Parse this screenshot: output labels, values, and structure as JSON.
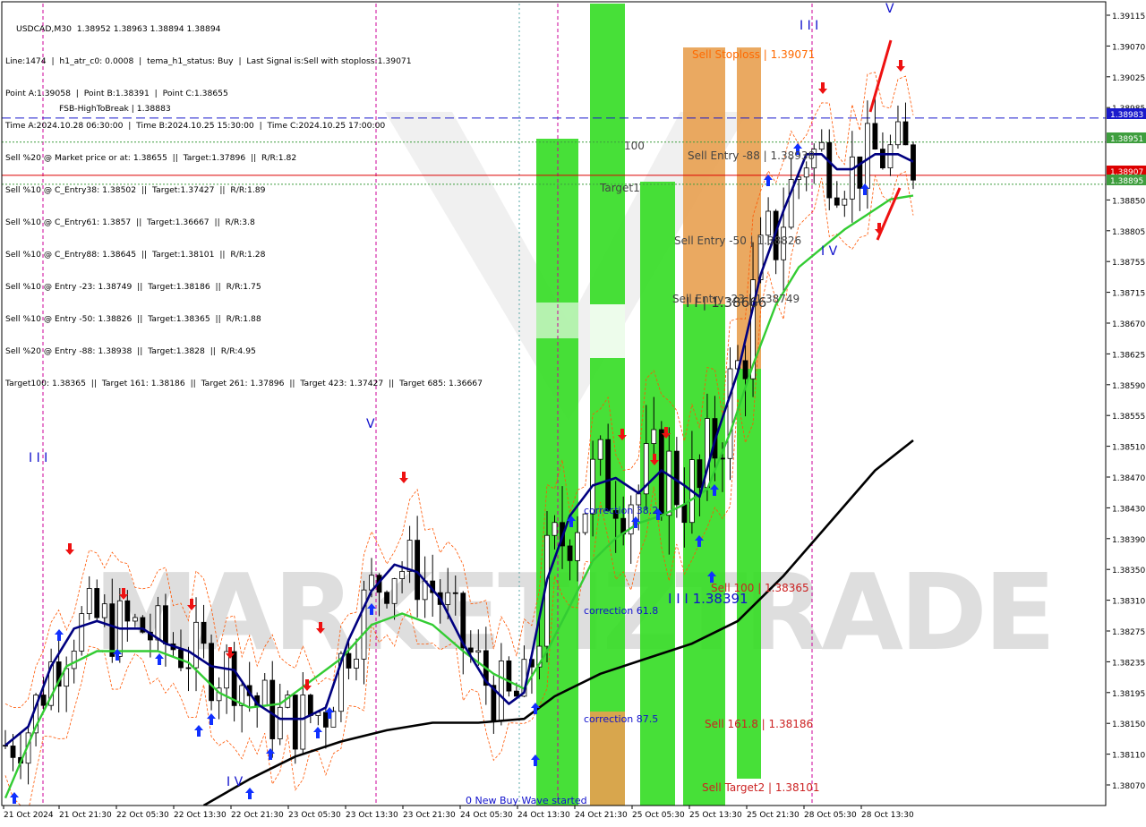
{
  "header": {
    "symbol_line": "USDCAD,M30  1.38952 1.38963 1.38894 1.38894",
    "info_lines": [
      "Line:1474  |  h1_atr_c0: 0.0008  |  tema_h1_status: Buy  |  Last Signal is:Sell with stoploss:1.39071",
      "Point A:1.39058  |  Point B:1.38391  |  Point C:1.38655",
      "Time A:2024.10.28 06:30:00  |  Time B:2024.10.25 15:30:00  |  Time C:2024.10.25 17:00:00",
      "Sell %20 @ Market price or at: 1.38655  ||  Target:1.37896  ||  R/R:1.82",
      "Sell %10 @ C_Entry38: 1.38502  ||  Target:1.37427  ||  R/R:1.89",
      "Sell %10 @ C_Entry61: 1.3857  ||  Target:1.36667  ||  R/R:3.8",
      "Sell %10 @ C_Entry88: 1.38645  ||  Target:1.38101  ||  R/R:1.28",
      "Sell %10 @ Entry -23: 1.38749  ||  Target:1.38186  ||  R/R:1.75",
      "Sell %10 @ Entry -50: 1.38826  ||  Target:1.38365  ||  R/R:1.88",
      "Sell %20 @ Entry -88: 1.38938  ||  Target:1.3828  ||  R/R:4.95",
      "Target100: 1.38365  ||  Target 161: 1.38186  ||  Target 261: 1.37896  ||  Target 423: 1.37427  ||  Target 685: 1.36667"
    ],
    "overlap_text": "FSB-HighToBreak | 1.38883"
  },
  "watermark": "MARKETIZTRADE",
  "price_axis": {
    "ticks": [
      "1.39115",
      "1.39070",
      "1.39025",
      "1.38985",
      "1.38940",
      "1.38895",
      "1.38850",
      "1.38805",
      "1.38755",
      "1.38715",
      "1.38670",
      "1.38625",
      "1.38590",
      "1.38555",
      "1.38510",
      "1.38470",
      "1.38430",
      "1.38390",
      "1.38350",
      "1.38310",
      "1.38275",
      "1.38235",
      "1.38195",
      "1.38150",
      "1.38110",
      "1.38070"
    ],
    "markers": [
      {
        "text": "1.38983",
        "color": "#1a1acc"
      },
      {
        "text": "1.38951",
        "color": "#3e9e3e"
      },
      {
        "text": "1.38907",
        "color": "#dd0000"
      },
      {
        "text": "1.38895",
        "color": "#3e9e3e"
      }
    ]
  },
  "time_axis": {
    "labels": [
      "21 Oct 2024",
      "21 Oct 21:30",
      "22 Oct 05:30",
      "22 Oct 13:30",
      "22 Oct 21:30",
      "23 Oct 05:30",
      "23 Oct 13:30",
      "23 Oct 21:30",
      "24 Oct 05:30",
      "24 Oct 13:30",
      "24 Oct 21:30",
      "25 Oct 05:30",
      "25 Oct 13:30",
      "25 Oct 21:30",
      "28 Oct 05:30",
      "28 Oct 13:30"
    ]
  },
  "annotations": {
    "sell_stoploss": "Sell Stoploss | 1.39071",
    "sell_entry_88": "Sell Entry -88 | 1.38938",
    "sell_entry_50": "Sell Entry -50 | 1.38826",
    "sell_entry_23": "Sell Entry -23 | 1.38749",
    "ii_label": "I I | 1.38666",
    "target1": "Target1",
    "hundred": "100",
    "sell_100": "Sell 100 | 1.38365",
    "iii_label": "I I I 1.38391",
    "sell_161": "Sell 161.8 | 1.38186",
    "sell_target2": "Sell Target2 | 1.38101",
    "correction_38": "correction 38.2",
    "correction_61": "correction 61.8",
    "correction_87": "correction 87.5",
    "new_buy_wave": "0 New Buy Wave started",
    "wave_labels": [
      "I I I",
      "V",
      "V",
      "I V",
      "I V",
      "I I I"
    ]
  },
  "colors": {
    "background": "#ffffff",
    "up_candle": "#000000",
    "ma_fast": "#000080",
    "ma_mid": "#33cc33",
    "ma_slow": "#000000",
    "bright_green": "#33dd22",
    "zone_orange": "#e8a050",
    "stoploss_text": "#ff6a00",
    "sell_text": "#cc2222",
    "blue_text": "#1010cc",
    "grey_text": "#444444",
    "buy_arrow": "#1030ff",
    "sell_arrow": "#ee1111",
    "session_line": "#cc0099"
  },
  "chart_data": {
    "type": "candlestick",
    "symbol": "USDCAD",
    "timeframe": "M30",
    "ylim": [
      1.3807,
      1.39135
    ],
    "hlines": [
      {
        "name": "blue dashed",
        "value": 1.38983,
        "color": "#1a1acc"
      },
      {
        "name": "green dotted",
        "value": 1.38951,
        "color": "#3e9e3e"
      },
      {
        "name": "red",
        "value": 1.38907,
        "color": "#dd0000"
      },
      {
        "name": "green dotted 2",
        "value": 1.38895,
        "color": "#3e9e3e"
      }
    ],
    "ma_fast": [
      [
        0,
        1.3815
      ],
      [
        3,
        1.38175
      ],
      [
        6,
        1.38255
      ],
      [
        9,
        1.38305
      ],
      [
        12,
        1.38315
      ],
      [
        15,
        1.38305
      ],
      [
        18,
        1.38305
      ],
      [
        21,
        1.38285
      ],
      [
        24,
        1.38275
      ],
      [
        27,
        1.38255
      ],
      [
        30,
        1.3825
      ],
      [
        33,
        1.38205
      ],
      [
        36,
        1.38185
      ],
      [
        39,
        1.38185
      ],
      [
        42,
        1.382
      ],
      [
        45,
        1.3829
      ],
      [
        48,
        1.38355
      ],
      [
        51,
        1.3839
      ],
      [
        54,
        1.3838
      ],
      [
        57,
        1.38345
      ],
      [
        60,
        1.38285
      ],
      [
        63,
        1.38235
      ],
      [
        66,
        1.38205
      ],
      [
        68,
        1.3822
      ],
      [
        71,
        1.3837
      ],
      [
        74,
        1.38455
      ],
      [
        77,
        1.38495
      ],
      [
        80,
        1.38505
      ],
      [
        83,
        1.38485
      ],
      [
        86,
        1.38515
      ],
      [
        89,
        1.38495
      ],
      [
        91,
        1.3848
      ],
      [
        93,
        1.38555
      ],
      [
        96,
        1.38645
      ],
      [
        99,
        1.38775
      ],
      [
        102,
        1.3886
      ],
      [
        105,
        1.38935
      ],
      [
        107,
        1.38935
      ],
      [
        109,
        1.38915
      ],
      [
        111,
        1.38915
      ],
      [
        114,
        1.38935
      ],
      [
        117,
        1.38935
      ],
      [
        119,
        1.38925
      ]
    ],
    "ma_mid": [
      [
        0,
        1.3808
      ],
      [
        4,
        1.38175
      ],
      [
        8,
        1.38255
      ],
      [
        12,
        1.38275
      ],
      [
        16,
        1.38275
      ],
      [
        20,
        1.38275
      ],
      [
        24,
        1.3826
      ],
      [
        28,
        1.3822
      ],
      [
        32,
        1.382
      ],
      [
        36,
        1.38205
      ],
      [
        40,
        1.38235
      ],
      [
        44,
        1.38265
      ],
      [
        48,
        1.3831
      ],
      [
        52,
        1.38325
      ],
      [
        56,
        1.3831
      ],
      [
        60,
        1.38275
      ],
      [
        64,
        1.38245
      ],
      [
        68,
        1.38225
      ],
      [
        71,
        1.38275
      ],
      [
        74,
        1.38335
      ],
      [
        77,
        1.38395
      ],
      [
        80,
        1.38425
      ],
      [
        83,
        1.38445
      ],
      [
        86,
        1.38455
      ],
      [
        89,
        1.3847
      ],
      [
        92,
        1.3849
      ],
      [
        95,
        1.38565
      ],
      [
        98,
        1.38655
      ],
      [
        101,
        1.38735
      ],
      [
        104,
        1.38785
      ],
      [
        107,
        1.3881
      ],
      [
        110,
        1.38835
      ],
      [
        113,
        1.38855
      ],
      [
        116,
        1.38875
      ],
      [
        119,
        1.3888
      ]
    ],
    "ma_slow": [
      [
        26,
        1.3807
      ],
      [
        32,
        1.38105
      ],
      [
        38,
        1.38135
      ],
      [
        44,
        1.38155
      ],
      [
        50,
        1.3817
      ],
      [
        56,
        1.3818
      ],
      [
        62,
        1.3818
      ],
      [
        68,
        1.38185
      ],
      [
        72,
        1.38215
      ],
      [
        78,
        1.38245
      ],
      [
        84,
        1.38265
      ],
      [
        90,
        1.38285
      ],
      [
        96,
        1.38315
      ],
      [
        102,
        1.38375
      ],
      [
        108,
        1.38445
      ],
      [
        114,
        1.38515
      ],
      [
        119,
        1.38555
      ]
    ]
  }
}
